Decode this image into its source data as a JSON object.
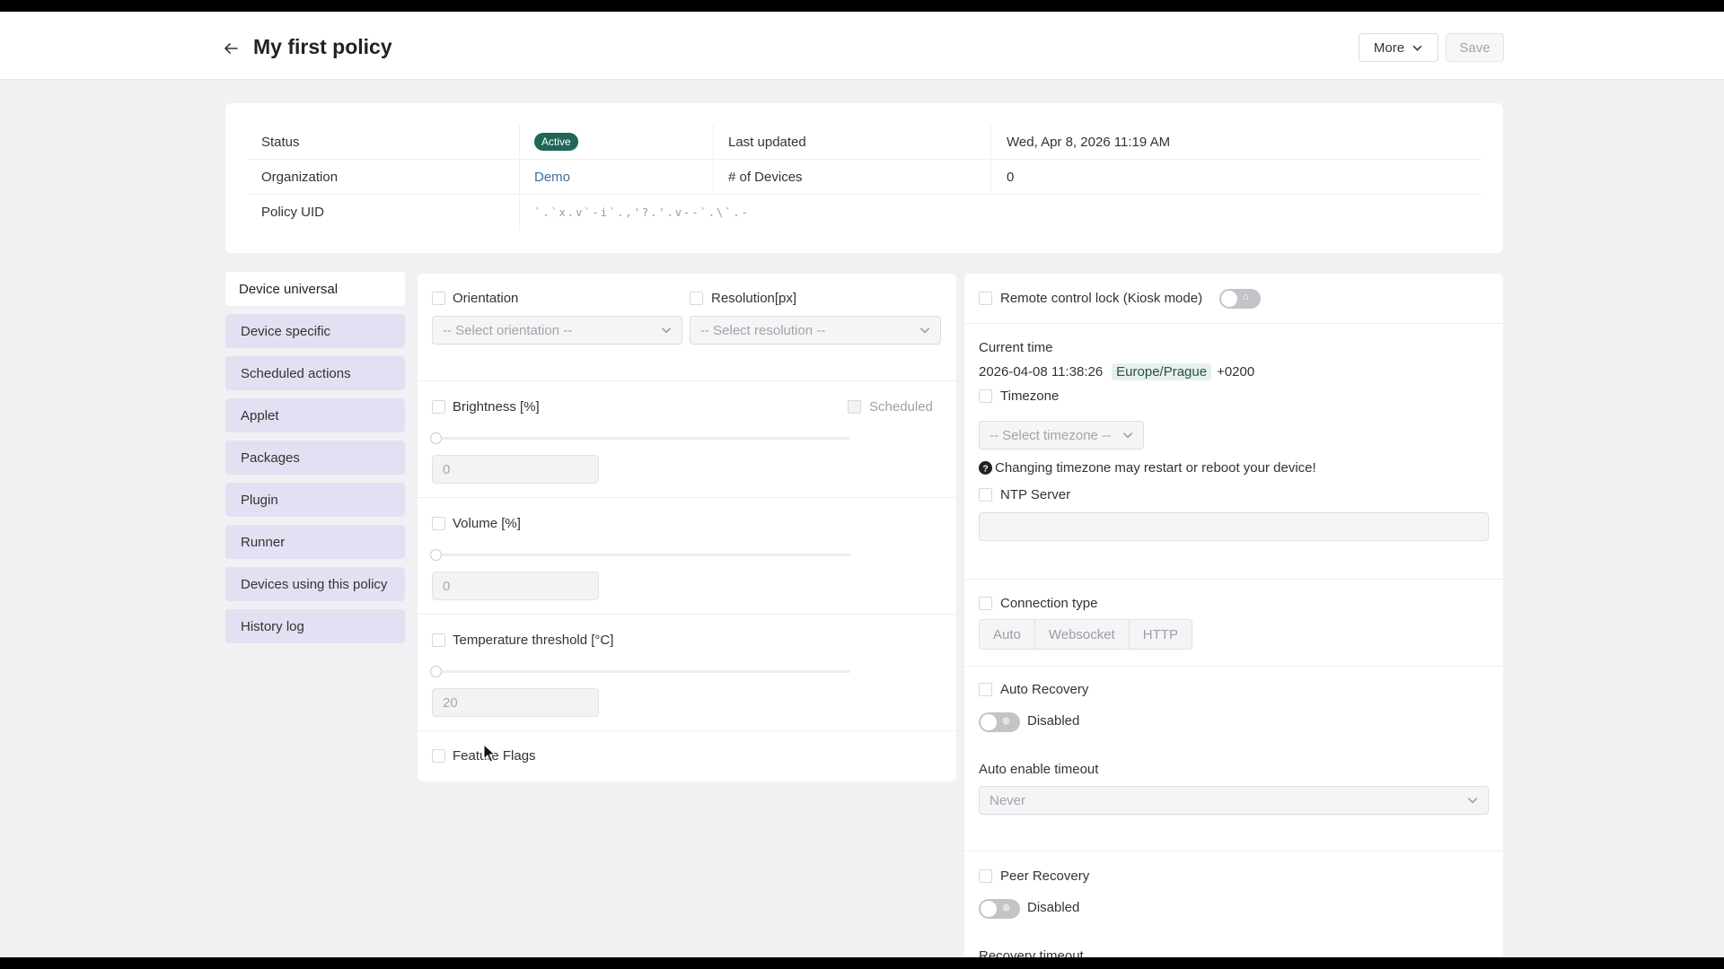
{
  "header": {
    "title": "My first policy",
    "more_label": "More",
    "save_label": "Save"
  },
  "info": {
    "status_label": "Status",
    "status_value": "Active",
    "last_updated_label": "Last updated",
    "last_updated_value": "Wed, Apr 8, 2026 11:19 AM",
    "organization_label": "Organization",
    "organization_value": "Demo",
    "devices_label": "# of Devices",
    "devices_value": "0",
    "uid_label": "Policy UID",
    "uid_value": "`.`x.v`-i`.,'?.'.v--`.\\`.-"
  },
  "sidebar": {
    "items": [
      {
        "label": "Device universal"
      },
      {
        "label": "Device specific"
      },
      {
        "label": "Scheduled actions"
      },
      {
        "label": "Applet"
      },
      {
        "label": "Packages"
      },
      {
        "label": "Plugin"
      },
      {
        "label": "Runner"
      },
      {
        "label": "Devices using this policy"
      },
      {
        "label": "History log"
      }
    ]
  },
  "universal": {
    "orientation_label": "Orientation",
    "orientation_placeholder": "-- Select orientation --",
    "resolution_label": "Resolution[px]",
    "resolution_placeholder": "-- Select resolution --",
    "brightness_label": "Brightness [%]",
    "brightness_value": "0",
    "scheduled_label": "Scheduled",
    "volume_label": "Volume [%]",
    "volume_value": "0",
    "temperature_label": "Temperature threshold [°C]",
    "temperature_value": "20",
    "feature_flags_label": "Feature Flags"
  },
  "right": {
    "kiosk_label": "Remote control lock (Kiosk mode)",
    "current_time_label": "Current time",
    "current_time_value": "2026-04-08 11:38:26",
    "timezone_tag": "Europe/Prague",
    "utc_offset": "+0200",
    "timezone_label": "Timezone",
    "timezone_placeholder": "-- Select timezone --",
    "timezone_warning": "Changing timezone may restart or reboot your device!",
    "ntp_label": "NTP Server",
    "connection_type_label": "Connection type",
    "connection_options": [
      "Auto",
      "Websocket",
      "HTTP"
    ],
    "auto_recovery_label": "Auto Recovery",
    "auto_recovery_state": "Disabled",
    "auto_enable_timeout_label": "Auto enable timeout",
    "auto_enable_timeout_value": "Never",
    "peer_recovery_label": "Peer Recovery",
    "peer_recovery_state": "Disabled",
    "recovery_timeout_label": "Recovery timeout"
  }
}
